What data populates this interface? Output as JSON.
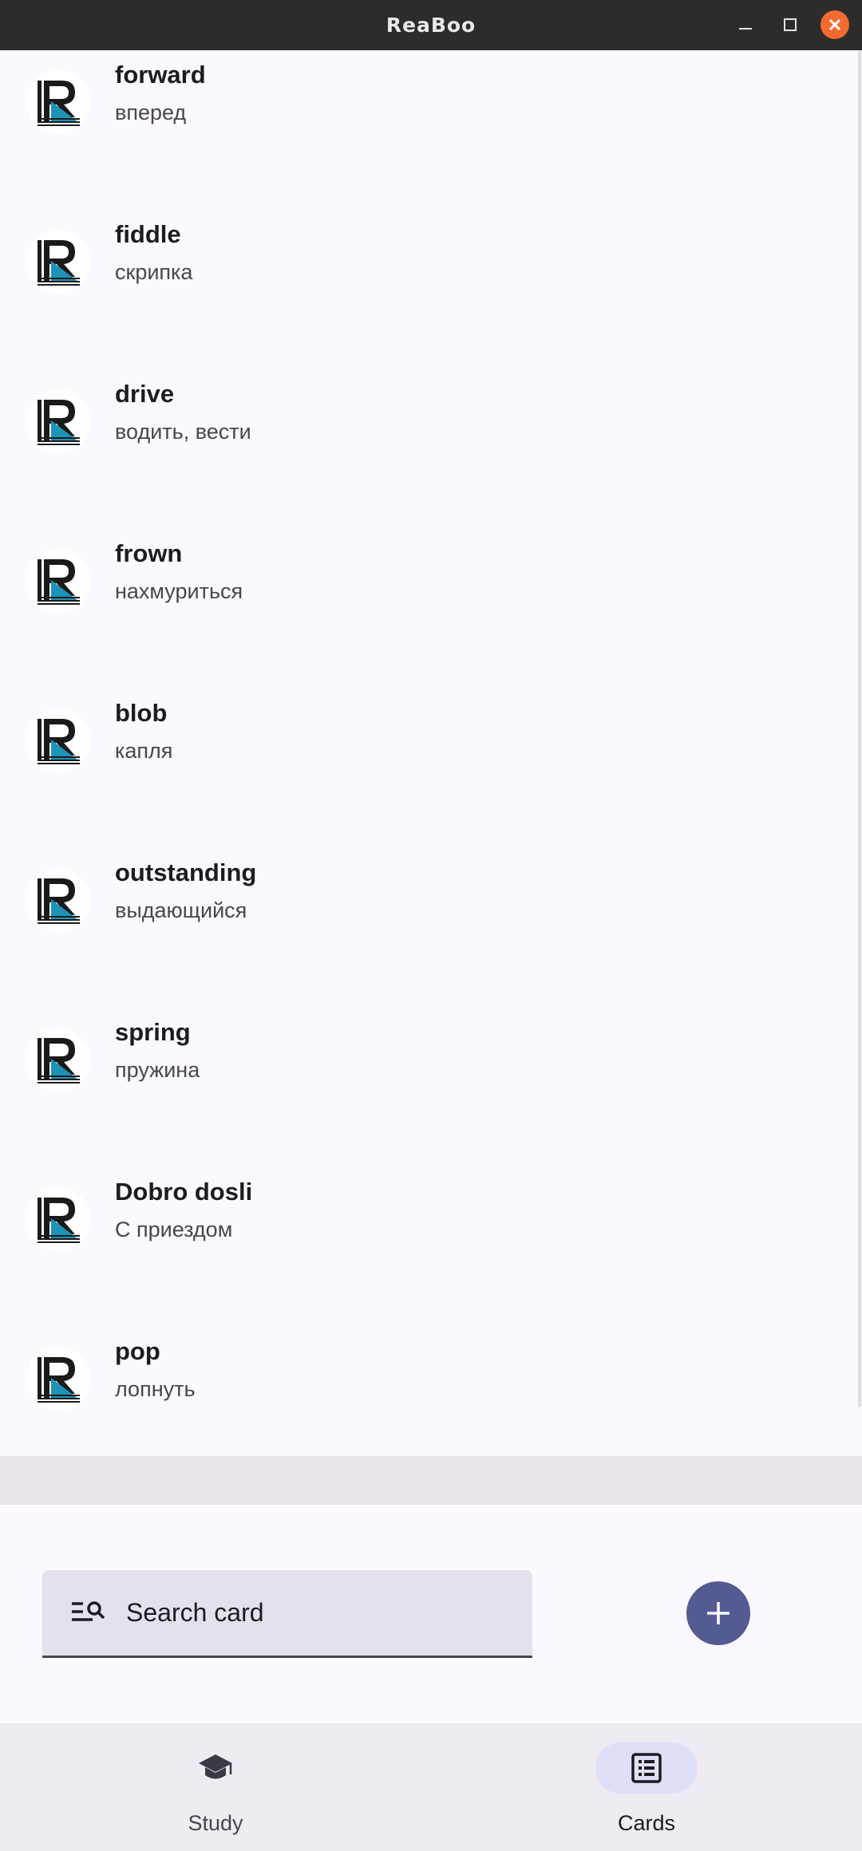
{
  "window": {
    "title": "ReaBoo",
    "controls": [
      "minimize-icon",
      "maximize-icon",
      "close-icon"
    ]
  },
  "cards": [
    {
      "word": "forward",
      "translation": "вперед"
    },
    {
      "word": "fiddle",
      "translation": "скрипка"
    },
    {
      "word": "drive",
      "translation": "водить, вести"
    },
    {
      "word": "frown",
      "translation": "нахмуриться"
    },
    {
      "word": "blob",
      "translation": "капля"
    },
    {
      "word": "outstanding",
      "translation": "выдающийся"
    },
    {
      "word": "spring",
      "translation": "пружина"
    },
    {
      "word": "Dobro dosli",
      "translation": "С приездом"
    },
    {
      "word": "pop",
      "translation": "лопнуть"
    }
  ],
  "search": {
    "placeholder": "Search card",
    "icon": "search-list-icon"
  },
  "fab": {
    "icon": "plus-icon"
  },
  "nav": {
    "items": [
      {
        "label": "Study",
        "icon": "graduation-cap-icon",
        "selected": false
      },
      {
        "label": "Cards",
        "icon": "list-icon",
        "selected": true
      }
    ]
  },
  "colors": {
    "background": "#fcf8ff",
    "titlebar": "#2c2c2c",
    "close": "#f36b31",
    "fab": "#545a92",
    "nav_selected": "#dfe0f8",
    "search_fill": "#e4e1ec"
  }
}
